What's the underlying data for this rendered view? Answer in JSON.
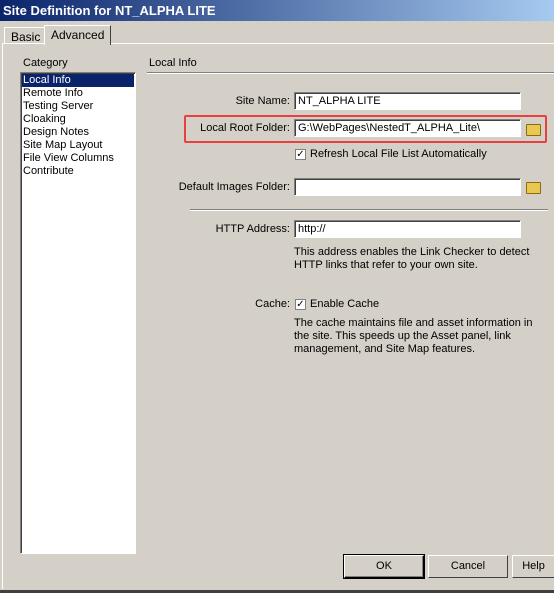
{
  "window": {
    "title": "Site Definition for NT_ALPHA LITE"
  },
  "tabs": [
    {
      "label": "Basic"
    },
    {
      "label": "Advanced",
      "active": true
    }
  ],
  "category": {
    "label": "Category",
    "items": [
      "Local Info",
      "Remote Info",
      "Testing Server",
      "Cloaking",
      "Design Notes",
      "Site Map Layout",
      "File View Columns",
      "Contribute"
    ],
    "selected": "Local Info"
  },
  "section": {
    "title": "Local Info"
  },
  "form": {
    "site_name_label": "Site Name:",
    "site_name_value": "NT_ALPHA LITE",
    "local_root_label": "Local Root Folder:",
    "local_root_value": "G:\\WebPages\\NestedT_ALPHA_Lite\\",
    "refresh_label": "Refresh Local File List Automatically",
    "refresh_checked": true,
    "default_images_label": "Default Images Folder:",
    "default_images_value": "",
    "http_label": "HTTP Address:",
    "http_value": "http://",
    "http_desc": "This address enables the Link Checker to detect HTTP links that refer to your own site.",
    "cache_label": "Cache:",
    "cache_checkbox_label": "Enable Cache",
    "cache_checked": true,
    "cache_desc": "The cache maintains file and asset information in the site.  This speeds up the Asset panel, link management, and Site Map features."
  },
  "highlight_color": "#e84040",
  "buttons": {
    "ok": "OK",
    "cancel": "Cancel",
    "help": "Help"
  }
}
